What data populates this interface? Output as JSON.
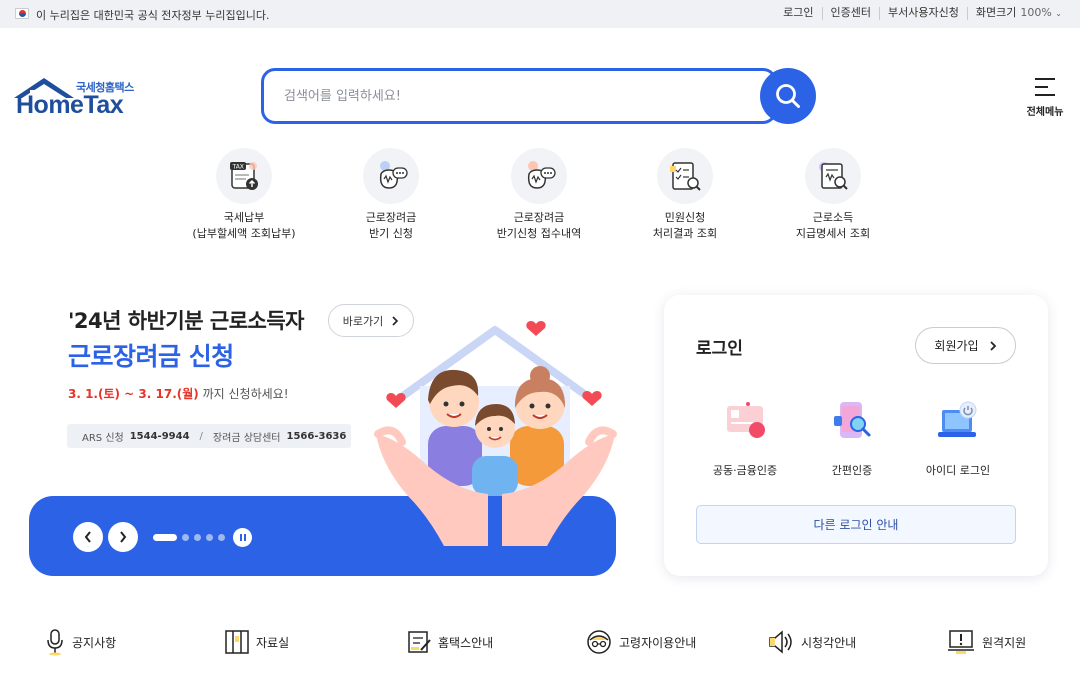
{
  "topbar": {
    "gov_text": "이 누리집은 대한민국 공식 전자정부 누리집입니다.",
    "links": [
      "로그인",
      "인증센터",
      "부서사용자신청",
      "화면크기"
    ],
    "zoom": "100%"
  },
  "logo": {
    "sub": "국세청홈택스",
    "main": "HomeTax"
  },
  "search": {
    "placeholder": "검색어를 입력하세요!"
  },
  "allmenu": {
    "label": "전체메뉴"
  },
  "quick_menu": [
    {
      "line1": "국세납부",
      "line2": "(납부할세액 조회납부)",
      "icon": "tax-payment-icon"
    },
    {
      "line1": "근로장려금",
      "line2": "반기 신청",
      "icon": "money-bag-icon"
    },
    {
      "line1": "근로장려금",
      "line2": "반기신청 접수내역",
      "icon": "money-bag-icon"
    },
    {
      "line1": "민원신청",
      "line2": "처리결과 조회",
      "icon": "checklist-search-icon"
    },
    {
      "line1": "근로소득",
      "line2": "지급명세서 조회",
      "icon": "document-search-icon"
    }
  ],
  "banner": {
    "headline1": "'24년 하반기분 근로소득자",
    "headline2": "근로장려금 신청",
    "go_label": "바로가기",
    "date_highlight": "3. 1.(토) ~ 3. 17.(월)",
    "date_suffix": " 까지 신청하세요!",
    "ars_label": "ARS 신청",
    "ars_number": "1544-9944",
    "center_label": "장려금 상담센터",
    "center_number": "1566-3636",
    "slide_count": 5,
    "active_slide": 1
  },
  "login": {
    "title": "로그인",
    "join_label": "회원가입",
    "methods": [
      {
        "label": "공동·금융인증",
        "icon": "certificate-card-icon"
      },
      {
        "label": "간편인증",
        "icon": "phone-search-icon"
      },
      {
        "label": "아이디 로그인",
        "icon": "laptop-power-icon"
      }
    ],
    "other_label": "다른 로그인 안내"
  },
  "bottom_links": [
    {
      "label": "공지사항",
      "icon": "microphone-icon"
    },
    {
      "label": "자료실",
      "icon": "archive-icon"
    },
    {
      "label": "홈택스안내",
      "icon": "guide-icon"
    },
    {
      "label": "고령자이용안내",
      "icon": "senior-icon"
    },
    {
      "label": "시청각안내",
      "icon": "speaker-icon"
    },
    {
      "label": "원격지원",
      "icon": "remote-support-icon"
    }
  ],
  "colors": {
    "primary": "#2c63e6",
    "accent_red": "#e5342a",
    "logo_blue": "#1f4e9c"
  }
}
